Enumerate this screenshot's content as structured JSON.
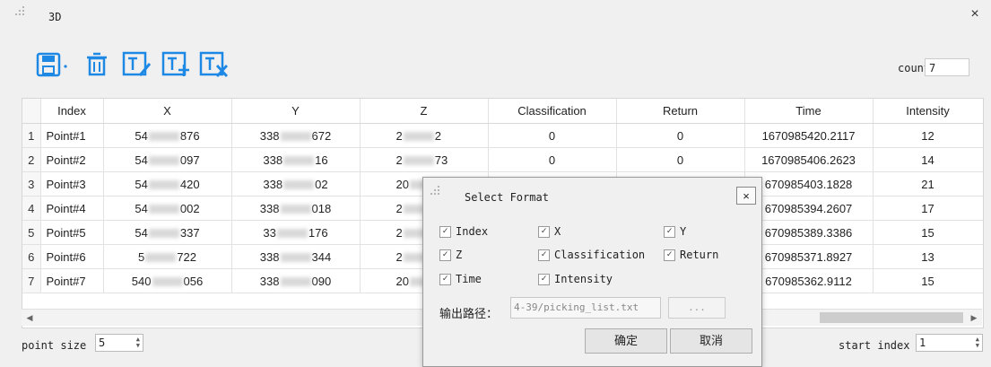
{
  "window": {
    "title": "3D",
    "close_icon": "×"
  },
  "toolbar": {
    "save_icon": "save-icon",
    "delete_icon": "delete-icon",
    "edit_icon": "edit-text-icon",
    "insert_icon": "insert-text-icon",
    "remove_icon": "remove-text-icon",
    "count_label": "count",
    "count_value": "7",
    "accent": "#1e88e5"
  },
  "table": {
    "columns": [
      "Index",
      "X",
      "Y",
      "Z",
      "Classification",
      "Return",
      "Time",
      "Intensity"
    ],
    "rows": [
      {
        "n": "1",
        "index": "Point#1",
        "x": [
          "54",
          "876"
        ],
        "y": [
          "338",
          "672"
        ],
        "z": [
          "2",
          "2"
        ],
        "cls": "0",
        "ret": "0",
        "time": "1670985420.2117",
        "intensity": "12"
      },
      {
        "n": "2",
        "index": "Point#2",
        "x": [
          "54",
          "097"
        ],
        "y": [
          "338",
          "16"
        ],
        "z": [
          "2",
          "73"
        ],
        "cls": "0",
        "ret": "0",
        "time": "1670985406.2623",
        "intensity": "14"
      },
      {
        "n": "3",
        "index": "Point#3",
        "x": [
          "54",
          "420"
        ],
        "y": [
          "338",
          "02"
        ],
        "z": [
          "20",
          ""
        ],
        "cls": "",
        "ret": "",
        "time": "670985403.1828",
        "intensity": "21"
      },
      {
        "n": "4",
        "index": "Point#4",
        "x": [
          "54",
          "002"
        ],
        "y": [
          "338",
          "018"
        ],
        "z": [
          "2",
          ""
        ],
        "cls": "",
        "ret": "",
        "time": "670985394.2607",
        "intensity": "17"
      },
      {
        "n": "5",
        "index": "Point#5",
        "x": [
          "54",
          "337"
        ],
        "y": [
          "33",
          "176"
        ],
        "z": [
          "2",
          ""
        ],
        "cls": "",
        "ret": "",
        "time": "670985389.3386",
        "intensity": "15"
      },
      {
        "n": "6",
        "index": "Point#6",
        "x": [
          "5",
          "722"
        ],
        "y": [
          "338",
          "344"
        ],
        "z": [
          "2",
          ""
        ],
        "cls": "",
        "ret": "",
        "time": "670985371.8927",
        "intensity": "13"
      },
      {
        "n": "7",
        "index": "Point#7",
        "x": [
          "540",
          "056"
        ],
        "y": [
          "338",
          "090"
        ],
        "z": [
          "20",
          ""
        ],
        "cls": "",
        "ret": "",
        "time": "670985362.9112",
        "intensity": "15"
      }
    ]
  },
  "bottom": {
    "point_size_label": "point size",
    "point_size_value": "5",
    "start_index_label": "start index",
    "start_index_value": "1"
  },
  "dialog": {
    "title": "Select Format",
    "close_icon": "×",
    "checkboxes": [
      {
        "label": "Index",
        "checked": true
      },
      {
        "label": "X",
        "checked": true
      },
      {
        "label": "Y",
        "checked": true
      },
      {
        "label": "Z",
        "checked": true
      },
      {
        "label": "Classification",
        "checked": true
      },
      {
        "label": "Return",
        "checked": true
      },
      {
        "label": "Time",
        "checked": true
      },
      {
        "label": "Intensity",
        "checked": true
      }
    ],
    "output_label": "输出路径：",
    "output_value": "4-39/picking_list.txt",
    "browse_label": "...",
    "ok_label": "确定",
    "cancel_label": "取消"
  }
}
